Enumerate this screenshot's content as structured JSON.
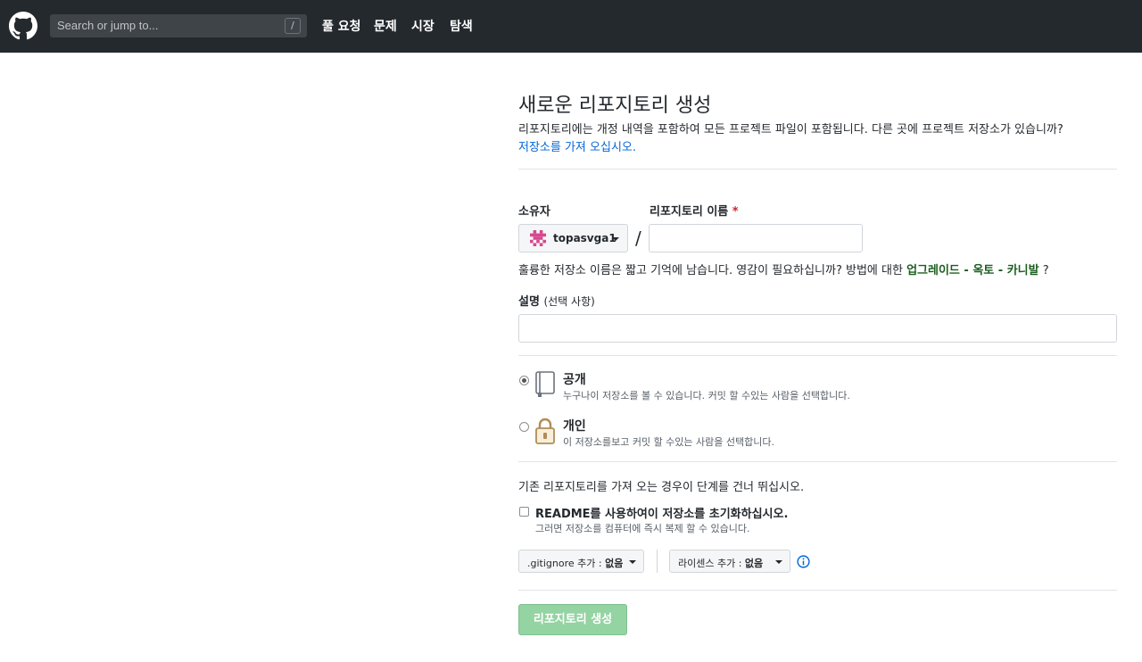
{
  "header": {
    "search_placeholder": "Search or jump to...",
    "search_shortcut": "/",
    "nav": [
      "풀 요청",
      "문제",
      "시장",
      "탐색"
    ]
  },
  "page": {
    "title": "새로운 리포지토리 생성",
    "subtitle": "리포지토리에는 개정 내역을 포함하여 모든 프로젝트 파일이 포함됩니다. 다른 곳에 프로젝트 저장소가 있습니까?",
    "import_link": "저장소를 가져 오십시오."
  },
  "form": {
    "owner_label": "소유자",
    "owner_value": "topasvga1",
    "repo_name_label": "리포지토리 이름",
    "required_mark": "*",
    "separator": "/",
    "repo_name_value": "",
    "hint_prefix": "훌륭한 저장소 이름은 짧고 기억에 남습니다. 영감이 필요하십니까? 방법에 대한 ",
    "hint_suggestion": "업그레이드 - 옥토 - 카니발",
    "hint_suffix": " ?",
    "description_label": "설명",
    "description_optional": "(선택 사항)",
    "description_value": ""
  },
  "visibility": {
    "selected": "public",
    "public_title": "공개",
    "public_desc": "누구나이 저장소를 볼 수 있습니다. 커밋 할 수있는 사람을 선택합니다.",
    "private_title": "개인",
    "private_desc": "이 저장소를보고 커밋 할 수있는 사람을 선택합니다."
  },
  "init": {
    "import_note": "기존 리포지토리를 가져 오는 경우이 단계를 건너 뛰십시오.",
    "readme_checked": false,
    "readme_label": "README를 사용하여이 저장소를 초기화하십시오.",
    "readme_desc": "그러면 저장소를 컴퓨터에 즉시 복제 할 수 있습니다.",
    "gitignore_label": ".gitignore 추가 :",
    "gitignore_value": "없음",
    "license_label": "라이센스 추가 :",
    "license_value": "없음"
  },
  "submit": {
    "create_label": "리포지토리 생성"
  },
  "colors": {
    "header_bg": "#24292e",
    "link": "#0366d6",
    "create_button_bg": "#94d3a2",
    "required": "#cb2431",
    "lock": "#b08d57"
  }
}
